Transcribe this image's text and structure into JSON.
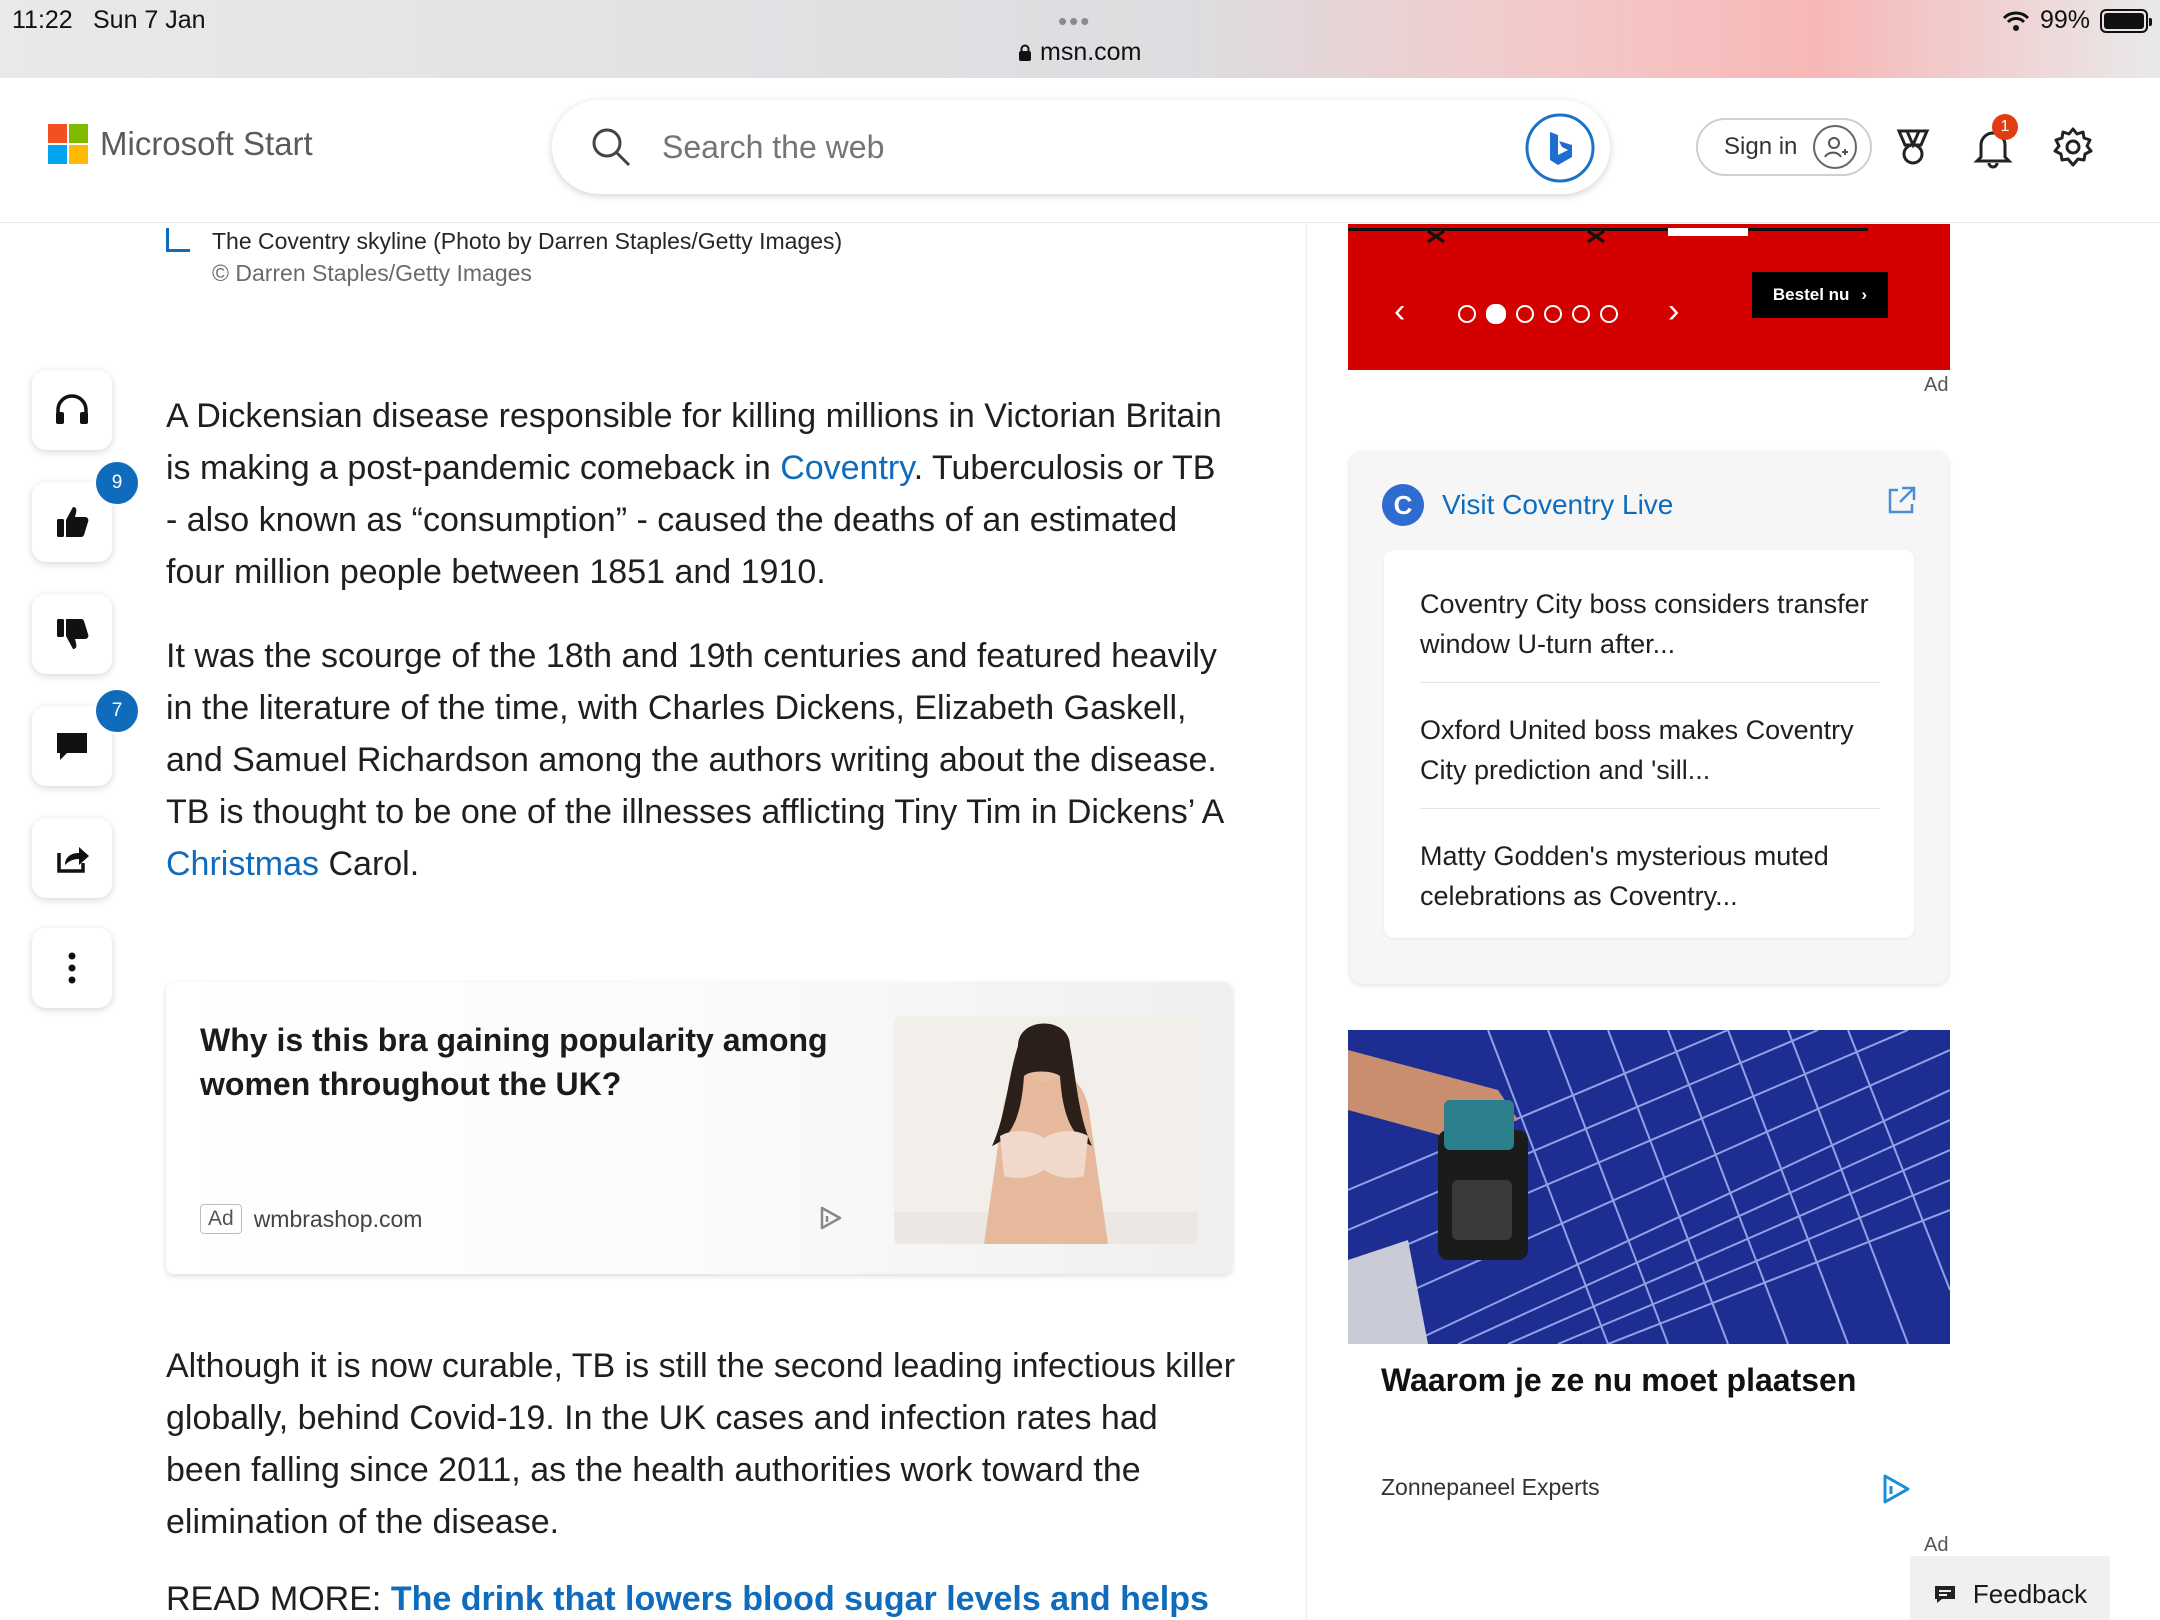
{
  "status_bar": {
    "time": "11:22",
    "date": "Sun 7 Jan",
    "url": "msn.com",
    "battery": "99%"
  },
  "header": {
    "logo_text": "Microsoft Start",
    "search_placeholder": "Search the web",
    "sign_in_label": "Sign in",
    "notification_count": "1"
  },
  "article": {
    "caption": "The Coventry skyline (Photo by Darren Staples/Getty Images)",
    "credit": "© Darren Staples/Getty Images",
    "p1": {
      "before": "A Dickensian disease responsible for killing millions in Victorian Britain is making a post-pandemic comeback in ",
      "link": "Coventry",
      "after": ". Tuberculosis or TB - also known as “consumption” - caused the deaths of an estimated four million people between 1851 and 1910."
    },
    "p2": {
      "before": "It was the scourge of the 18th and 19th centuries and featured heavily in the literature of the time, with Charles Dickens, Elizabeth Gaskell, and Samuel Richardson among the authors writing about the disease. TB is thought to be one of the illnesses afflicting Tiny Tim in Dickens’ A ",
      "link": "Christmas",
      "after": " Carol."
    },
    "p3": "Although it is now curable, TB is still the second leading infectious killer globally, behind Covid-19. In the UK cases and infection rates had been falling since 2011, as the health authorities work toward the elimination of the disease.",
    "read_more_label": "READ MORE: ",
    "read_more_link": "The drink that lowers blood sugar levels and helps"
  },
  "rail": {
    "like_count": "9",
    "comment_count": "7"
  },
  "inline_ad": {
    "title": "Why is this bra gaining popularity among women throughout the UK?",
    "tag": "Ad",
    "source": "wmbrashop.com"
  },
  "banner_ad": {
    "cta": "Bestel nu",
    "ad_label": "Ad",
    "prev": "‹",
    "next": "›"
  },
  "coventry_card": {
    "title": "Visit Coventry Live",
    "badge_letter": "C",
    "items": [
      "Coventry City boss considers transfer window U-turn after...",
      "Oxford United boss makes Coventry City prediction and 'sill...",
      "Matty Godden's mysterious muted celebrations as Coventry..."
    ]
  },
  "promo_ad": {
    "title": "Waarom je ze nu moet plaatsen",
    "source": "Zonnepaneel Experts",
    "ad_label": "Ad"
  },
  "feedback_label": "Feedback",
  "colors": {
    "accent": "#0f6cbd",
    "banner_red": "#d40000",
    "notification": "#e03d12"
  }
}
